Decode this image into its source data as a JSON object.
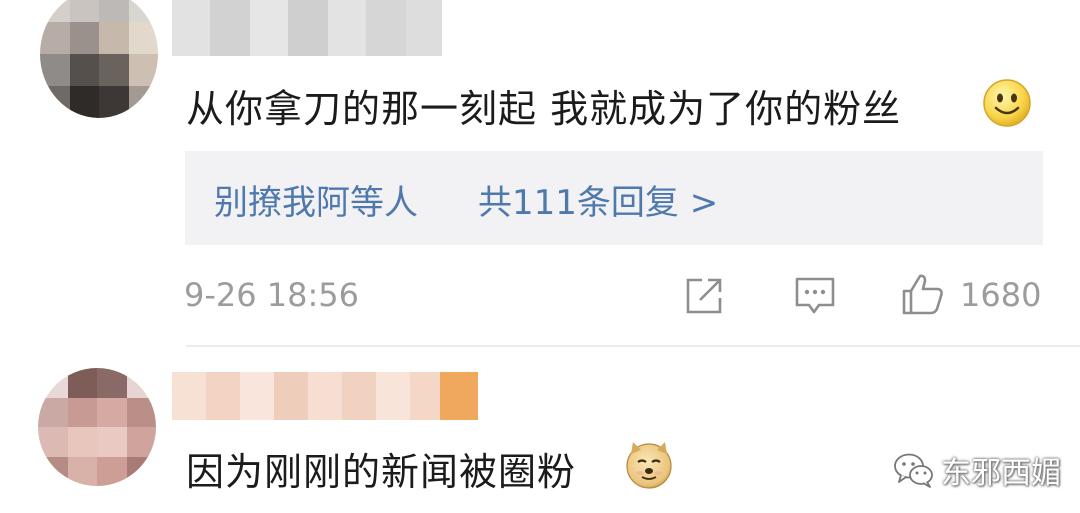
{
  "comments": [
    {
      "text": "从你拿刀的那一刻起 我就成为了你的粉丝",
      "emoji": "smile-emoji",
      "replies": {
        "users": "别撩我阿等人",
        "count": "共111条回复 >"
      },
      "timestamp": "9-26 18:56",
      "likes": "1680",
      "avatar_blurred": true,
      "username_blurred": true
    },
    {
      "text": "因为刚刚的新闻被圈粉",
      "emoji": "doge-emoji",
      "avatar_blurred": true,
      "username_blurred": true
    }
  ],
  "icons": {
    "share": "share-icon",
    "reply": "comment-icon",
    "like": "thumbs-up-icon"
  },
  "colors": {
    "link_blue": "#4f79ad",
    "meta_gray": "#9c9c9c",
    "reply_bg": "#f2f2f4"
  },
  "watermark": {
    "text": "东邪西媚"
  }
}
